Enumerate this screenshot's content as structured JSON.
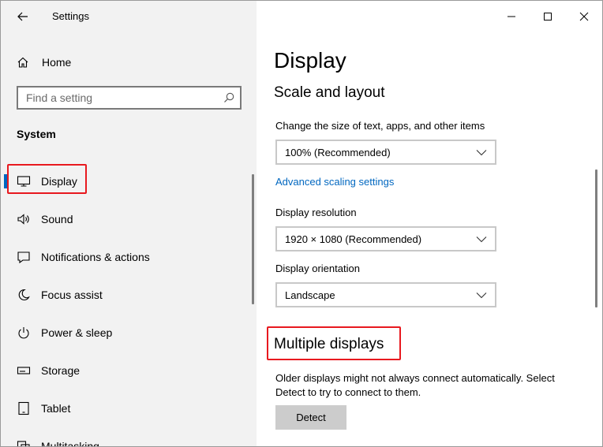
{
  "window": {
    "title": "Settings"
  },
  "sidebar": {
    "home_label": "Home",
    "search_placeholder": "Find a setting",
    "section": "System",
    "items": [
      {
        "label": "Display",
        "icon": "monitor-icon",
        "selected": true
      },
      {
        "label": "Sound",
        "icon": "speaker-icon"
      },
      {
        "label": "Notifications & actions",
        "icon": "notification-icon"
      },
      {
        "label": "Focus assist",
        "icon": "moon-icon"
      },
      {
        "label": "Power & sleep",
        "icon": "power-icon"
      },
      {
        "label": "Storage",
        "icon": "storage-icon"
      },
      {
        "label": "Tablet",
        "icon": "tablet-icon"
      },
      {
        "label": "Multitasking",
        "icon": "multitasking-icon"
      }
    ]
  },
  "main": {
    "title": "Display",
    "scale_heading": "Scale and layout",
    "scale_label": "Change the size of text, apps, and other items",
    "scale_value": "100% (Recommended)",
    "advanced_link": "Advanced scaling settings",
    "resolution_label": "Display resolution",
    "resolution_value": "1920 × 1080 (Recommended)",
    "orientation_label": "Display orientation",
    "orientation_value": "Landscape",
    "multiple_heading": "Multiple displays",
    "multiple_desc": "Older displays might not always connect automatically. Select Detect to try to connect to them.",
    "detect_button": "Detect"
  },
  "colors": {
    "accent": "#0067c0",
    "highlight": "#e8191f",
    "sidebar_bg": "#f2f2f2"
  }
}
